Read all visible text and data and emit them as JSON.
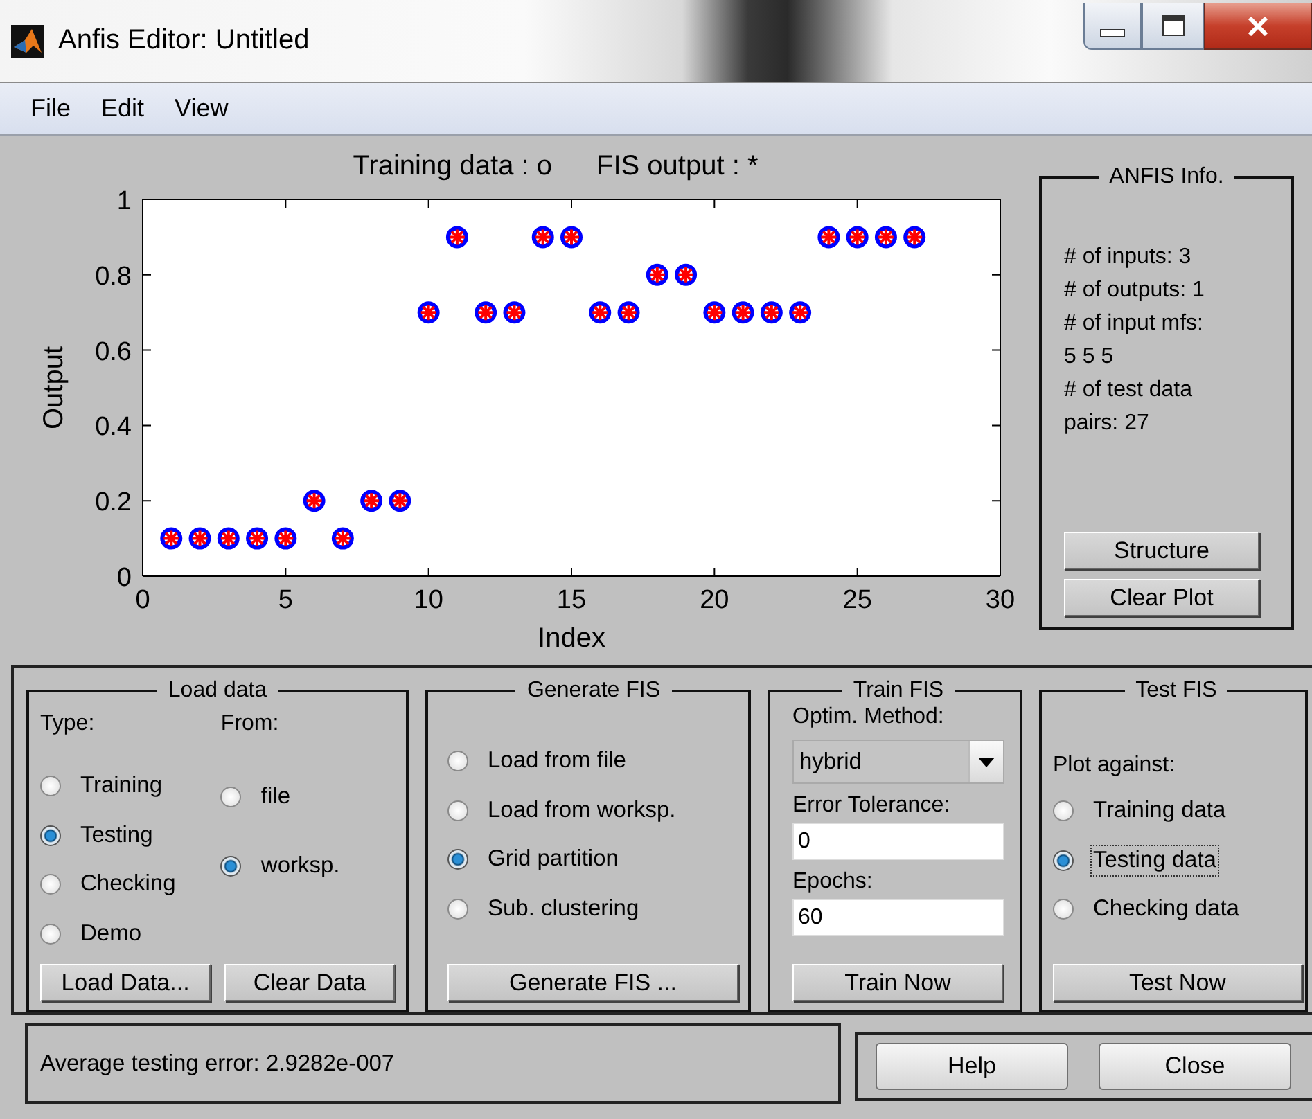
{
  "window": {
    "title": "Anfis Editor: Untitled"
  },
  "menu": [
    {
      "label": "File"
    },
    {
      "label": "Edit"
    },
    {
      "label": "View"
    }
  ],
  "plot": {
    "legend_separator": " : ",
    "legend_symbols": [
      "o",
      "*"
    ],
    "chart_data": {
      "type": "scatter",
      "xlabel": "Index",
      "ylabel": "Output",
      "x": [
        1,
        2,
        3,
        4,
        5,
        6,
        7,
        8,
        9,
        10,
        11,
        12,
        13,
        14,
        15,
        16,
        17,
        18,
        19,
        20,
        21,
        22,
        23,
        24,
        25,
        26,
        27
      ],
      "series": [
        {
          "name": "Training data",
          "marker": "circle",
          "color": "#0000ff",
          "values": [
            0.1,
            0.1,
            0.1,
            0.1,
            0.1,
            0.2,
            0.1,
            0.2,
            0.2,
            0.7,
            0.9,
            0.7,
            0.7,
            0.9,
            0.9,
            0.7,
            0.7,
            0.8,
            0.8,
            0.7,
            0.7,
            0.7,
            0.7,
            0.9,
            0.9,
            0.9,
            0.9
          ]
        },
        {
          "name": "FIS output",
          "marker": "cross",
          "color": "#ff0000",
          "values": [
            0.1,
            0.1,
            0.1,
            0.1,
            0.1,
            0.2,
            0.1,
            0.2,
            0.2,
            0.7,
            0.9,
            0.7,
            0.7,
            0.9,
            0.9,
            0.7,
            0.7,
            0.8,
            0.8,
            0.7,
            0.7,
            0.7,
            0.7,
            0.9,
            0.9,
            0.9,
            0.9
          ]
        }
      ],
      "xlim": [
        0,
        30
      ],
      "ylim": [
        0,
        1
      ],
      "xticks": [
        0,
        5,
        10,
        15,
        20,
        25,
        30
      ],
      "yticks": [
        0,
        0.2,
        0.4,
        0.6,
        0.8,
        1
      ]
    }
  },
  "anfis_info": {
    "title": "ANFIS Info.",
    "lines": [
      "# of inputs: 3",
      "# of outputs: 1",
      "# of input mfs:",
      "5  5  5",
      "# of test data",
      "pairs: 27"
    ],
    "buttons": [
      "Structure",
      "Clear Plot"
    ]
  },
  "load_data": {
    "title": "Load data",
    "type_label": "Type:",
    "from_label": "From:",
    "type_options": [
      {
        "label": "Training",
        "selected": false
      },
      {
        "label": "Testing",
        "selected": true
      },
      {
        "label": "Checking",
        "selected": false
      },
      {
        "label": "Demo",
        "selected": false
      }
    ],
    "from_options": [
      {
        "label": "file",
        "selected": false
      },
      {
        "label": "worksp.",
        "selected": true
      }
    ],
    "buttons": [
      "Load Data...",
      "Clear Data"
    ]
  },
  "generate_fis": {
    "title": "Generate FIS",
    "options": [
      {
        "label": "Load from file",
        "selected": false
      },
      {
        "label": "Load from worksp.",
        "selected": false
      },
      {
        "label": "Grid partition",
        "selected": true
      },
      {
        "label": "Sub. clustering",
        "selected": false
      }
    ],
    "button": "Generate FIS ..."
  },
  "train_fis": {
    "title": "Train FIS",
    "method_label": "Optim. Method:",
    "method": "hybrid",
    "tolerance_label": "Error Tolerance:",
    "tolerance": "0",
    "epochs_label": "Epochs:",
    "epochs": "60",
    "button": "Train Now"
  },
  "test_fis": {
    "title": "Test FIS",
    "plot_against_label": "Plot against:",
    "options": [
      {
        "label": "Training data",
        "selected": false,
        "focused": false
      },
      {
        "label": "Testing data",
        "selected": true,
        "focused": true
      },
      {
        "label": "Checking data",
        "selected": false,
        "focused": false
      }
    ],
    "button": "Test Now"
  },
  "status": "Average testing error: 2.9282e-007",
  "buttons": [
    "Help",
    "Close"
  ]
}
